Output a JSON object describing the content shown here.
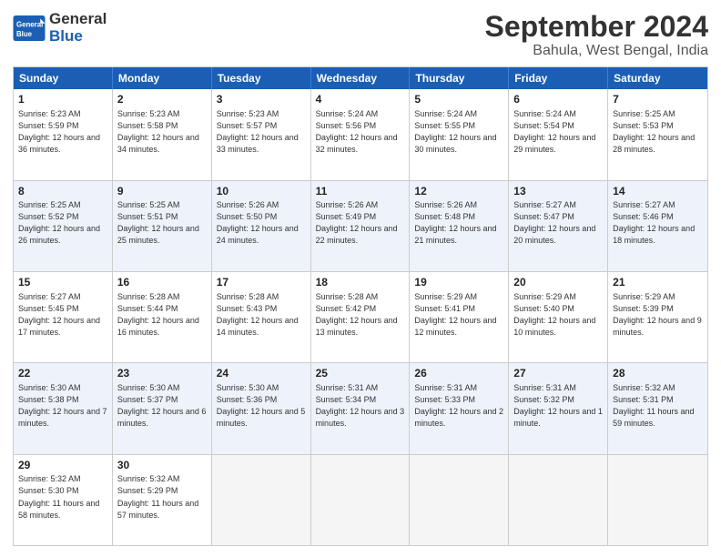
{
  "header": {
    "logo_text_general": "General",
    "logo_text_blue": "Blue",
    "month_title": "September 2024",
    "location": "Bahula, West Bengal, India"
  },
  "calendar": {
    "days_of_week": [
      "Sunday",
      "Monday",
      "Tuesday",
      "Wednesday",
      "Thursday",
      "Friday",
      "Saturday"
    ],
    "rows": [
      [
        {
          "day": "",
          "empty": true
        },
        {
          "day": "2",
          "sunrise": "5:23 AM",
          "sunset": "5:58 PM",
          "daylight": "12 hours and 34 minutes."
        },
        {
          "day": "3",
          "sunrise": "5:23 AM",
          "sunset": "5:57 PM",
          "daylight": "12 hours and 33 minutes."
        },
        {
          "day": "4",
          "sunrise": "5:24 AM",
          "sunset": "5:56 PM",
          "daylight": "12 hours and 32 minutes."
        },
        {
          "day": "5",
          "sunrise": "5:24 AM",
          "sunset": "5:55 PM",
          "daylight": "12 hours and 30 minutes."
        },
        {
          "day": "6",
          "sunrise": "5:24 AM",
          "sunset": "5:54 PM",
          "daylight": "12 hours and 29 minutes."
        },
        {
          "day": "7",
          "sunrise": "5:25 AM",
          "sunset": "5:53 PM",
          "daylight": "12 hours and 28 minutes."
        }
      ],
      [
        {
          "day": "8",
          "sunrise": "5:25 AM",
          "sunset": "5:52 PM",
          "daylight": "12 hours and 26 minutes."
        },
        {
          "day": "9",
          "sunrise": "5:25 AM",
          "sunset": "5:51 PM",
          "daylight": "12 hours and 25 minutes."
        },
        {
          "day": "10",
          "sunrise": "5:26 AM",
          "sunset": "5:50 PM",
          "daylight": "12 hours and 24 minutes."
        },
        {
          "day": "11",
          "sunrise": "5:26 AM",
          "sunset": "5:49 PM",
          "daylight": "12 hours and 22 minutes."
        },
        {
          "day": "12",
          "sunrise": "5:26 AM",
          "sunset": "5:48 PM",
          "daylight": "12 hours and 21 minutes."
        },
        {
          "day": "13",
          "sunrise": "5:27 AM",
          "sunset": "5:47 PM",
          "daylight": "12 hours and 20 minutes."
        },
        {
          "day": "14",
          "sunrise": "5:27 AM",
          "sunset": "5:46 PM",
          "daylight": "12 hours and 18 minutes."
        }
      ],
      [
        {
          "day": "15",
          "sunrise": "5:27 AM",
          "sunset": "5:45 PM",
          "daylight": "12 hours and 17 minutes."
        },
        {
          "day": "16",
          "sunrise": "5:28 AM",
          "sunset": "5:44 PM",
          "daylight": "12 hours and 16 minutes."
        },
        {
          "day": "17",
          "sunrise": "5:28 AM",
          "sunset": "5:43 PM",
          "daylight": "12 hours and 14 minutes."
        },
        {
          "day": "18",
          "sunrise": "5:28 AM",
          "sunset": "5:42 PM",
          "daylight": "12 hours and 13 minutes."
        },
        {
          "day": "19",
          "sunrise": "5:29 AM",
          "sunset": "5:41 PM",
          "daylight": "12 hours and 12 minutes."
        },
        {
          "day": "20",
          "sunrise": "5:29 AM",
          "sunset": "5:40 PM",
          "daylight": "12 hours and 10 minutes."
        },
        {
          "day": "21",
          "sunrise": "5:29 AM",
          "sunset": "5:39 PM",
          "daylight": "12 hours and 9 minutes."
        }
      ],
      [
        {
          "day": "22",
          "sunrise": "5:30 AM",
          "sunset": "5:38 PM",
          "daylight": "12 hours and 7 minutes."
        },
        {
          "day": "23",
          "sunrise": "5:30 AM",
          "sunset": "5:37 PM",
          "daylight": "12 hours and 6 minutes."
        },
        {
          "day": "24",
          "sunrise": "5:30 AM",
          "sunset": "5:36 PM",
          "daylight": "12 hours and 5 minutes."
        },
        {
          "day": "25",
          "sunrise": "5:31 AM",
          "sunset": "5:34 PM",
          "daylight": "12 hours and 3 minutes."
        },
        {
          "day": "26",
          "sunrise": "5:31 AM",
          "sunset": "5:33 PM",
          "daylight": "12 hours and 2 minutes."
        },
        {
          "day": "27",
          "sunrise": "5:31 AM",
          "sunset": "5:32 PM",
          "daylight": "12 hours and 1 minute."
        },
        {
          "day": "28",
          "sunrise": "5:32 AM",
          "sunset": "5:31 PM",
          "daylight": "11 hours and 59 minutes."
        }
      ],
      [
        {
          "day": "29",
          "sunrise": "5:32 AM",
          "sunset": "5:30 PM",
          "daylight": "11 hours and 58 minutes."
        },
        {
          "day": "30",
          "sunrise": "5:32 AM",
          "sunset": "5:29 PM",
          "daylight": "11 hours and 57 minutes."
        },
        {
          "day": "",
          "empty": true
        },
        {
          "day": "",
          "empty": true
        },
        {
          "day": "",
          "empty": true
        },
        {
          "day": "",
          "empty": true
        },
        {
          "day": "",
          "empty": true
        }
      ]
    ],
    "first_row": [
      {
        "day": "1",
        "sunrise": "5:23 AM",
        "sunset": "5:59 PM",
        "daylight": "12 hours and 36 minutes."
      }
    ]
  }
}
